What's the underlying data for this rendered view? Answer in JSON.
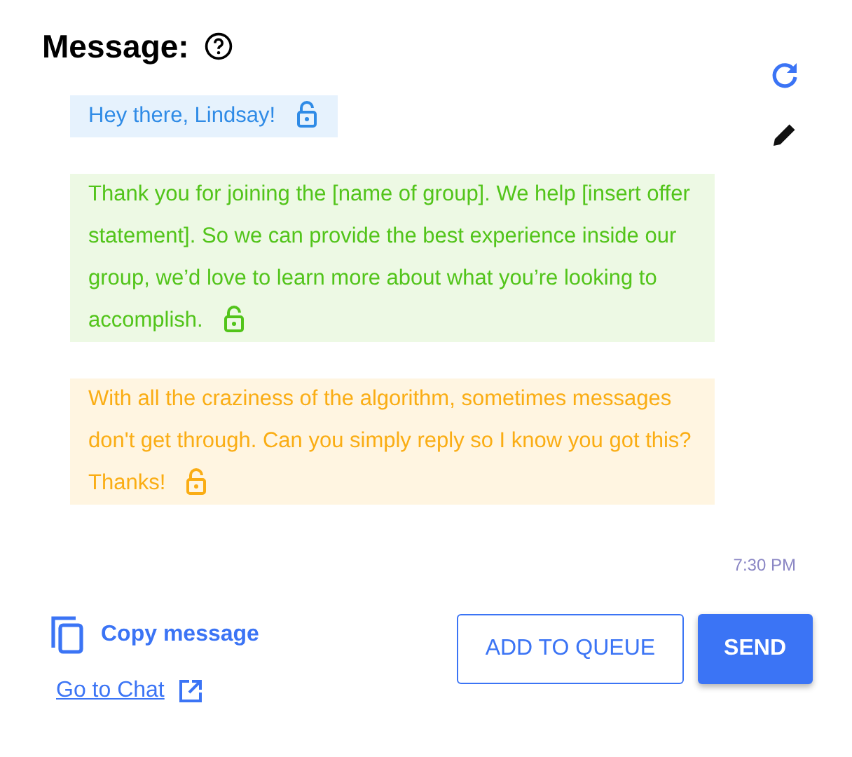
{
  "title": "Message:",
  "segments": [
    {
      "text": "Hey there, Lindsay!",
      "color": "#2f8be6",
      "lock_open": true
    },
    {
      "text": "Thank you for joining the [name of group]. We help [insert offer statement]. So we can provide the best experience inside our group, we’d love to learn more about what you’re looking to accomplish.",
      "color": "#52c41a",
      "lock_open": true
    },
    {
      "text": "With all the craziness of the algorithm, sometimes messages don't get through. Can you simply reply so I know you got this? Thanks!",
      "color": "#faad14",
      "lock_open": true
    }
  ],
  "time": "7:30 PM",
  "copy_label": "Copy message",
  "chat_link": "Go to Chat",
  "buttons": [
    {
      "label": "ADD TO QUEUE",
      "kind": "outline"
    },
    {
      "label": "SEND",
      "kind": "primary"
    }
  ]
}
